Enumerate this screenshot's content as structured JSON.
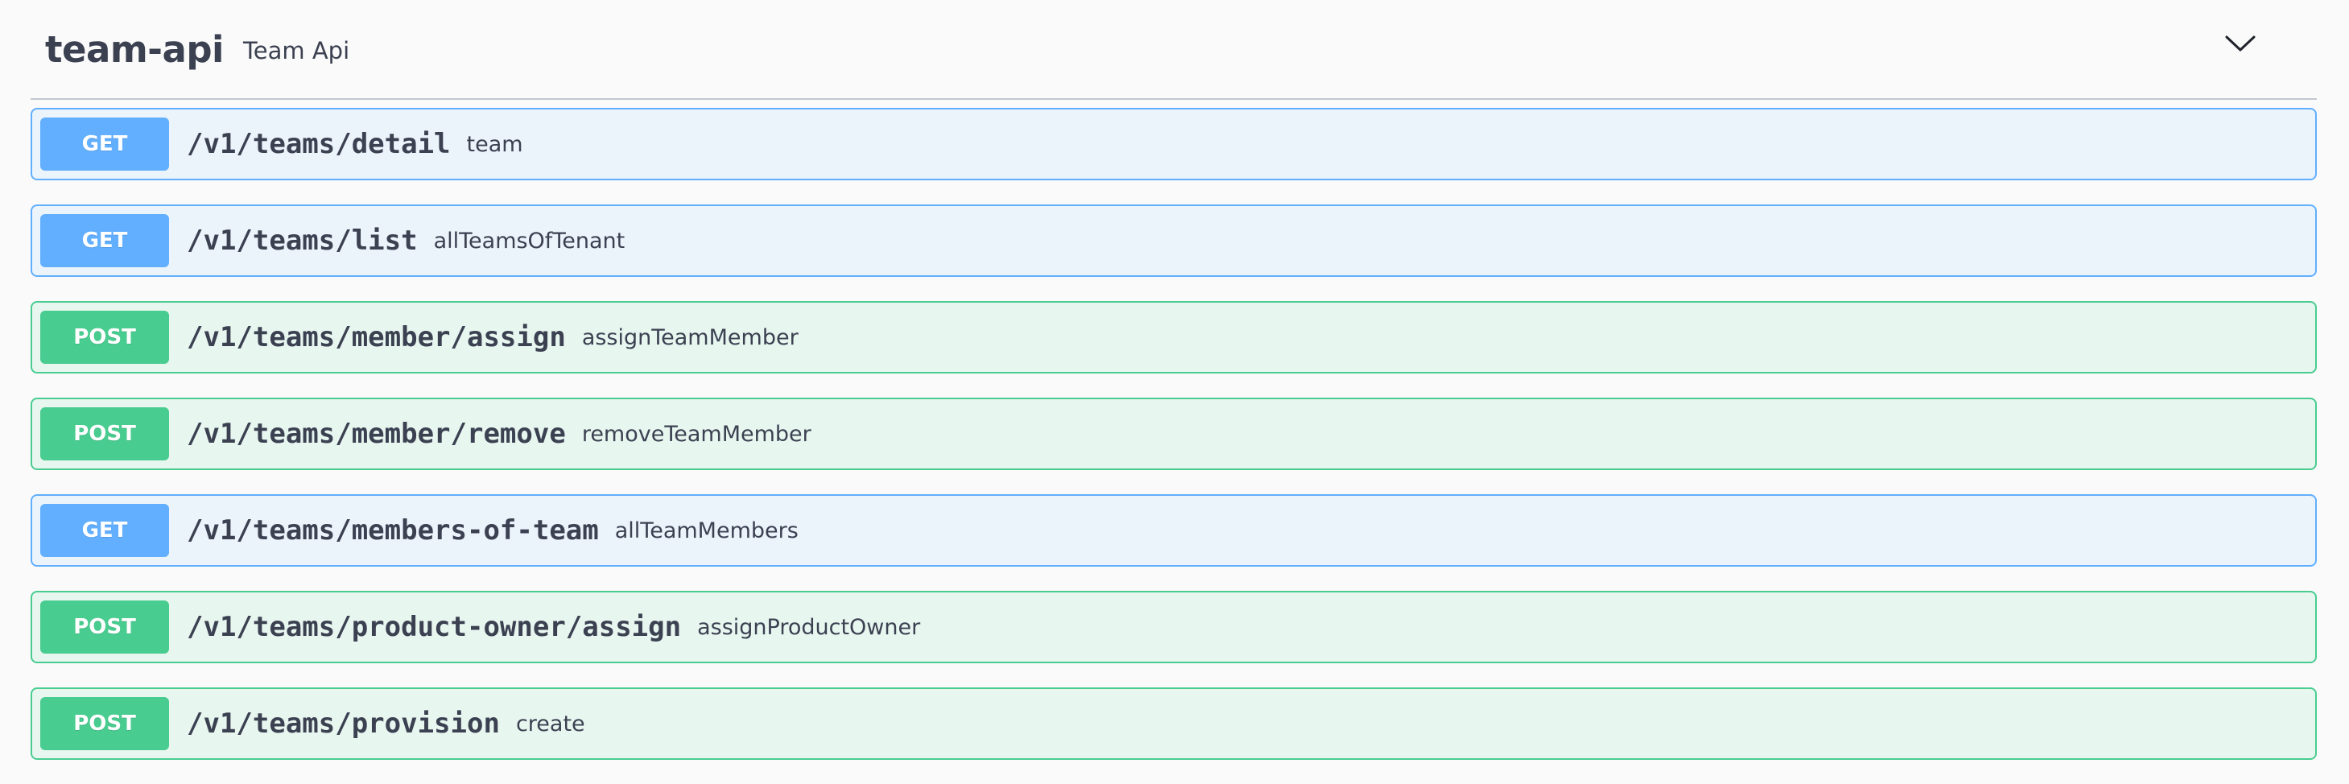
{
  "tag": {
    "name": "team-api",
    "description": "Team Api",
    "toggle_icon": "chevron-down-icon"
  },
  "colors": {
    "get": "#61affe",
    "get_bg": "#ebf3fb",
    "post": "#49cc90",
    "post_bg": "#e8f6f0",
    "text": "#3b4151"
  },
  "operations": [
    {
      "method": "GET",
      "path": "/v1/teams/detail",
      "summary": "team"
    },
    {
      "method": "GET",
      "path": "/v1/teams/list",
      "summary": "allTeamsOfTenant"
    },
    {
      "method": "POST",
      "path": "/v1/teams/member/assign",
      "summary": "assignTeamMember"
    },
    {
      "method": "POST",
      "path": "/v1/teams/member/remove",
      "summary": "removeTeamMember"
    },
    {
      "method": "GET",
      "path": "/v1/teams/members-of-team",
      "summary": "allTeamMembers"
    },
    {
      "method": "POST",
      "path": "/v1/teams/product-owner/assign",
      "summary": "assignProductOwner"
    },
    {
      "method": "POST",
      "path": "/v1/teams/provision",
      "summary": "create"
    }
  ]
}
